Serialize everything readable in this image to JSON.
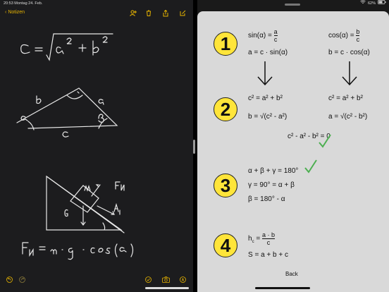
{
  "status": {
    "time": "20:53",
    "date": "Montag 24. Feb.",
    "battery": "62%"
  },
  "notes": {
    "back_label": "Notizen",
    "handwriting": {
      "formula1": "c = √(a² + b²)",
      "triangle_labels": [
        "b",
        "a",
        "α",
        "β",
        "c"
      ],
      "forces": [
        "F_N",
        "F_A",
        "F_G",
        "α",
        "m"
      ],
      "formula2": "F_N = m · g · cos(α)"
    }
  },
  "cheat_sheet": {
    "steps": [
      "1",
      "2",
      "3",
      "4"
    ],
    "step1": {
      "sin_lhs": "sin(α) =",
      "sin_num": "a",
      "sin_den": "c",
      "sin_solved": "a = c · sin(α)",
      "cos_lhs": "cos(α) =",
      "cos_num": "b",
      "cos_den": "c",
      "cos_solved": "b = c · cos(α)"
    },
    "step2": {
      "left_pyth": "c² = a² + b²",
      "left_b": "b = √(c² - a²)",
      "right_pyth": "c² = a² + b²",
      "right_a": "a = √(c² - b²)",
      "zero": "c² - a² - b² = 0"
    },
    "step3": {
      "sum": "α + β + γ = 180°",
      "gamma": "γ = 90° = α + β",
      "beta": "β = 180° - α"
    },
    "step4": {
      "h_lhs": "h",
      "h_sub": "c",
      "h_num": "a · b",
      "h_den": "c",
      "perimeter": "S = a + b + c"
    },
    "back_label": "Back"
  },
  "colors": {
    "accent": "#e6b300",
    "step_badge": "#ffe53a",
    "check": "#4caf50",
    "card": "#d9d9d9",
    "notes_bg": "#1c1c1e"
  }
}
